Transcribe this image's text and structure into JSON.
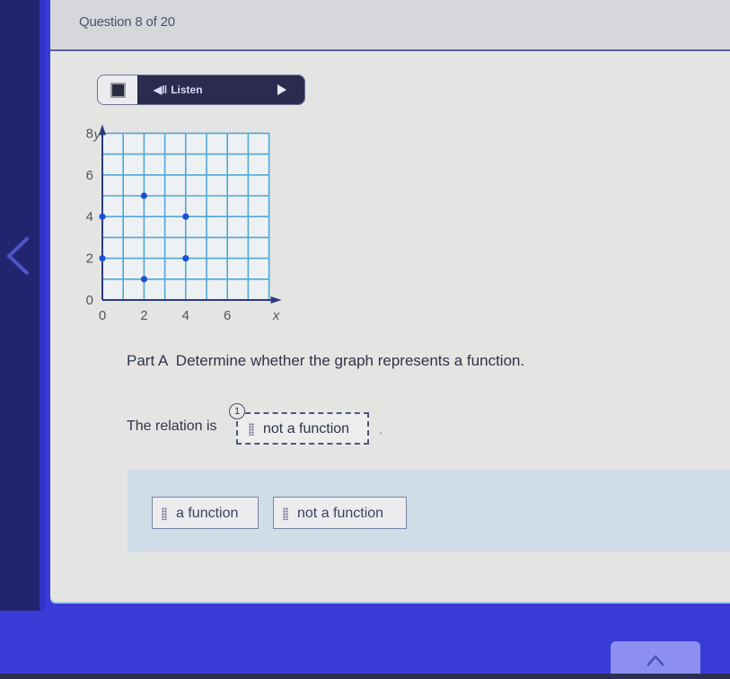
{
  "header": {
    "question_counter": "Question 8 of 20"
  },
  "toolbar": {
    "stop_icon": "stop-square-icon",
    "speaker_icon": "speaker-icon",
    "listen_label": "Listen",
    "play_icon": "play-icon"
  },
  "navigation": {
    "prev_icon": "chevron-left-icon",
    "scroll_top_icon": "chevron-up-icon"
  },
  "graph": {
    "type": "scatter",
    "x_label": "x",
    "y_label": "y",
    "x_range": [
      0,
      8
    ],
    "y_range": [
      0,
      8
    ],
    "grid_step": 1,
    "x_ticks": [
      "0",
      "2",
      "4",
      "6"
    ],
    "y_ticks": [
      "0",
      "2",
      "4",
      "6",
      "8"
    ],
    "points": [
      [
        0,
        2
      ],
      [
        0,
        4
      ],
      [
        2,
        1
      ],
      [
        2,
        5
      ],
      [
        4,
        2
      ],
      [
        4,
        4
      ]
    ],
    "point_color": "#1d4fd1",
    "grid_color": "#4ea8d8",
    "axis_color": "#2a3a80"
  },
  "question": {
    "prompt": "Part A  Determine whether the graph represents a function.",
    "relation_prefix": "The relation is",
    "blank_number": "1",
    "blank_answer": "not a function",
    "suffix": "."
  },
  "answer_bank": {
    "choices": [
      "a function",
      "not a function"
    ]
  }
}
